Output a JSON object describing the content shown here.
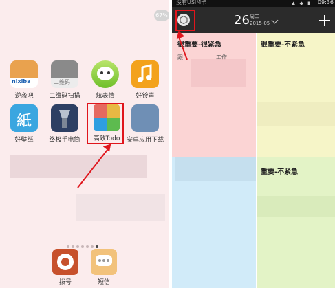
{
  "home": {
    "battery": "67%",
    "apps": [
      {
        "label": "逆袭吧",
        "icon": "nixiba-app-icon",
        "brand": "nixiba"
      },
      {
        "label": "二维码扫描",
        "icon": "qr-scanner-app-icon",
        "brand": "二维码"
      },
      {
        "label": "炫表情",
        "icon": "emoji-face-app-icon"
      },
      {
        "label": "好铃声",
        "icon": "music-note-app-icon"
      },
      {
        "label": "好壁纸",
        "icon": "wallpaper-app-icon",
        "glyph": "紙"
      },
      {
        "label": "终极手电筒",
        "icon": "flashlight-app-icon"
      },
      {
        "label": "高效Todo",
        "icon": "todo-app-icon"
      },
      {
        "label": "安卓应用下载",
        "icon": "android-store-app-icon"
      }
    ],
    "page_count": 7,
    "active_page": 6,
    "dock": [
      {
        "label": "拨号",
        "icon": "phone-dial-icon"
      },
      {
        "label": "短信",
        "icon": "sms-message-icon"
      }
    ]
  },
  "todo": {
    "status": {
      "carrier": "没有USIM卡",
      "time": "09:36"
    },
    "date": {
      "day": "26",
      "weekday": "周二",
      "year_month": "2015-05"
    },
    "quadrants": [
      {
        "title": "很重要-很紧急",
        "items": [
          "跟",
          "工作"
        ]
      },
      {
        "title": "很重要-不紧急",
        "items": []
      },
      {
        "title": "",
        "items": []
      },
      {
        "title": "重要-不紧急",
        "items": []
      }
    ]
  },
  "colors": {
    "annotation_red": "#e0151c",
    "q1": "#fbd4d4",
    "q2": "#f6f5c8",
    "q3": "#d1ebf9",
    "q4": "#e3f3c6",
    "topbar": "#2b2b2b"
  }
}
